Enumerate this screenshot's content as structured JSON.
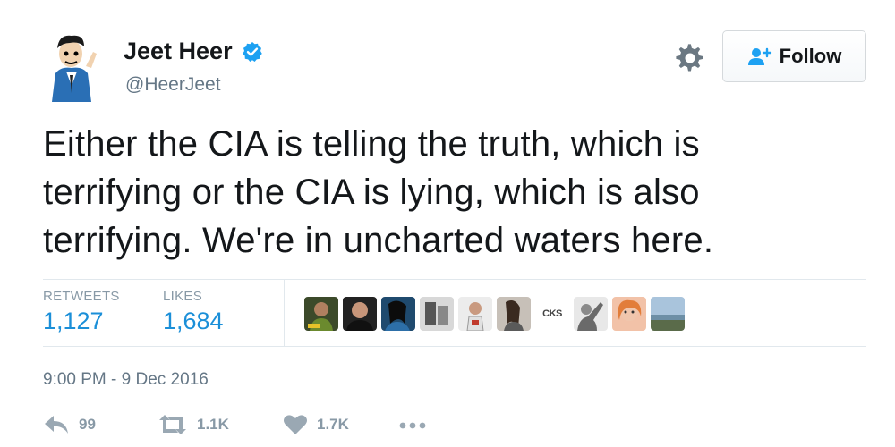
{
  "author": {
    "display_name": "Jeet Heer",
    "handle": "@HeerJeet",
    "verified": true
  },
  "follow_button": {
    "label": "Follow"
  },
  "tweet": {
    "text_lines": [
      "Either the CIA is telling the truth, which is",
      "terrifying or the CIA is lying, which is also",
      "terrifying. We're in uncharted waters here."
    ],
    "timestamp": "9:00 PM - 9 Dec 2016"
  },
  "stats": {
    "retweets_label": "RETWEETS",
    "retweets_value": "1,127",
    "likes_label": "LIKES",
    "likes_value": "1,684"
  },
  "liker_avatar_caption": "CKS",
  "actions": {
    "reply_count": "99",
    "retweet_count": "1.1K",
    "like_count": "1.7K"
  },
  "colors": {
    "link_blue": "#1b8fd8",
    "verified_blue": "#1da1f2",
    "muted_gray": "#8899a6"
  }
}
